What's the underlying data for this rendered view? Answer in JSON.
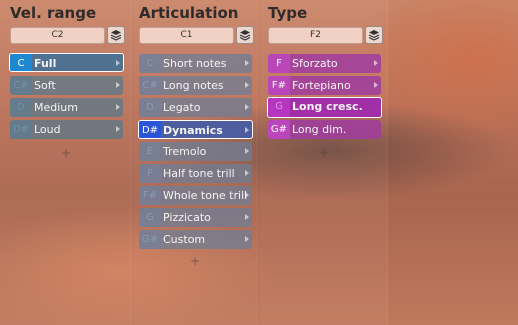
{
  "columns": [
    {
      "title": "Vel. range",
      "note": "C2",
      "items": [
        {
          "key": "C",
          "label": "Full",
          "selected": true
        },
        {
          "key": "C#",
          "label": "Soft"
        },
        {
          "key": "D",
          "label": "Medium"
        },
        {
          "key": "D#",
          "label": "Loud"
        }
      ],
      "add_symbol": "+"
    },
    {
      "title": "Articulation",
      "note": "C1",
      "items": [
        {
          "key": "C",
          "label": "Short notes"
        },
        {
          "key": "C#",
          "label": "Long notes"
        },
        {
          "key": "D",
          "label": "Legato"
        },
        {
          "key": "D#",
          "label": "Dynamics",
          "selected": true
        },
        {
          "key": "E",
          "label": "Tremolo"
        },
        {
          "key": "F",
          "label": "Half tone trill"
        },
        {
          "key": "F#",
          "label": "Whole tone trill"
        },
        {
          "key": "G",
          "label": "Pizzicato"
        },
        {
          "key": "G#",
          "label": "Custom"
        }
      ],
      "add_symbol": "+"
    },
    {
      "title": "Type",
      "note": "F2",
      "items": [
        {
          "key": "F",
          "label": "Sforzato"
        },
        {
          "key": "F#",
          "label": "Fortepiano"
        },
        {
          "key": "G",
          "label": "Long cresc.",
          "selected": true
        },
        {
          "key": "G#",
          "label": "Long dim."
        }
      ],
      "add_symbol": "+"
    }
  ],
  "icons": {
    "layer": "layers-icon",
    "expand": "chevron-right-icon",
    "add": "plus-icon"
  },
  "colors": {
    "selected_blue": "#1e88d0",
    "selected_articulation": "#2a55d8",
    "type_magenta": "#b736bf"
  }
}
